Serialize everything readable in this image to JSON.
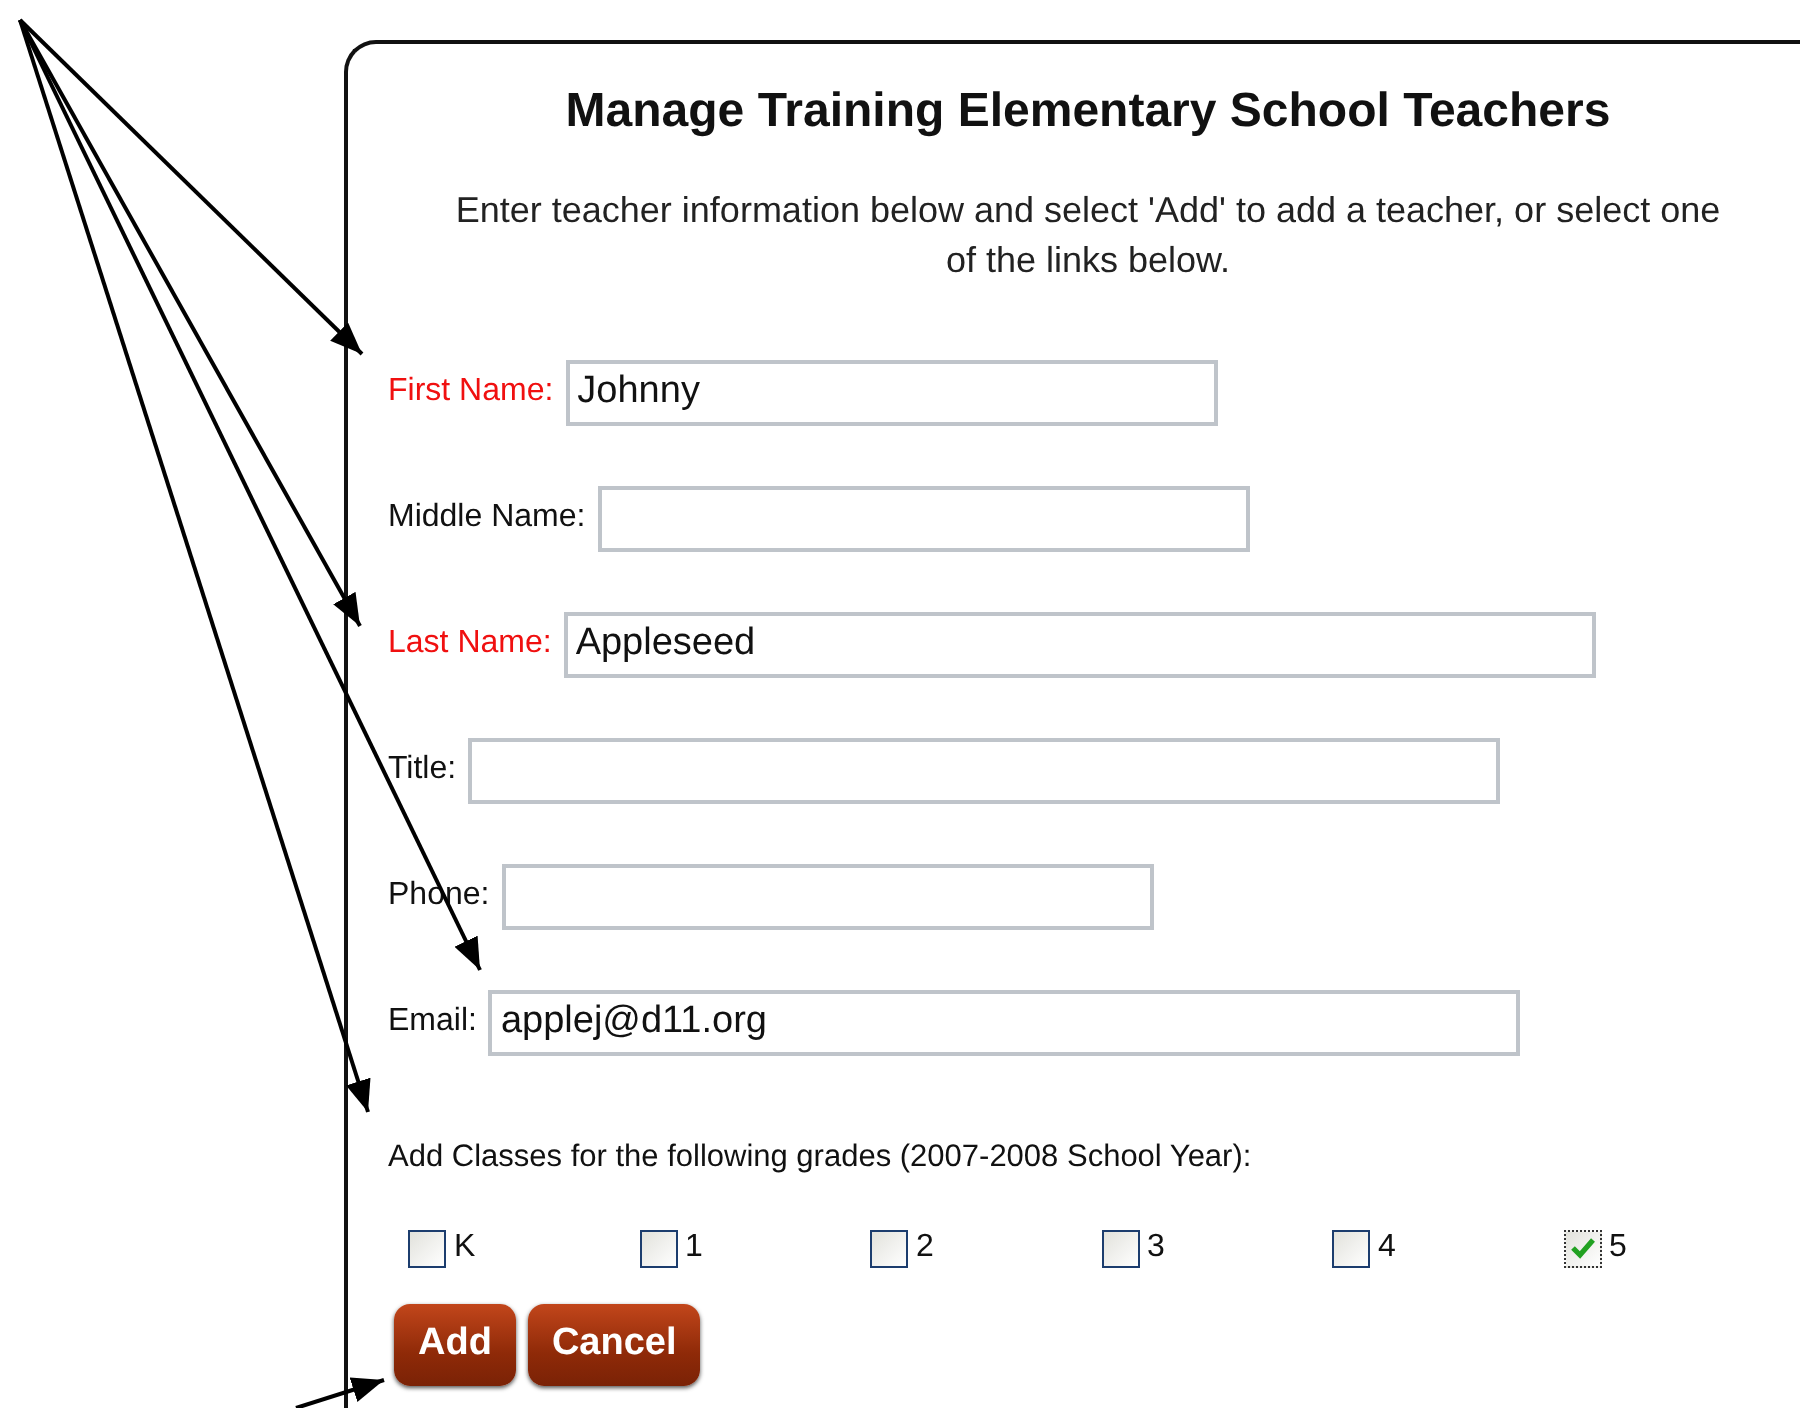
{
  "title": "Manage Training Elementary School Teachers",
  "instructions": "Enter teacher information below and select 'Add' to add a teacher, or select one of the links below.",
  "fields": [
    {
      "label": "First Name:",
      "value": "Johnny",
      "required": true,
      "kind": "short"
    },
    {
      "label": "Middle Name:",
      "required": false,
      "kind": "short"
    },
    {
      "label": "Last Name:",
      "value": "Appleseed",
      "required": true,
      "kind": "long"
    },
    {
      "label": "Title:",
      "required": false,
      "kind": "long"
    },
    {
      "label": "Phone:",
      "required": false,
      "kind": "short"
    },
    {
      "label": "Email:",
      "value": "applej@d11.org",
      "required": false,
      "kind": "long"
    }
  ],
  "grades_label": "Add Classes for the following grades (2007-2008 School Year):",
  "grades": [
    {
      "label": "K",
      "checked": false
    },
    {
      "label": "1",
      "checked": false
    },
    {
      "label": "2",
      "checked": false
    },
    {
      "label": "3",
      "checked": false
    },
    {
      "label": "4",
      "checked": false
    },
    {
      "label": "5",
      "checked": true
    }
  ],
  "buttons": [
    {
      "label": "Add"
    },
    {
      "label": "Cancel"
    }
  ]
}
